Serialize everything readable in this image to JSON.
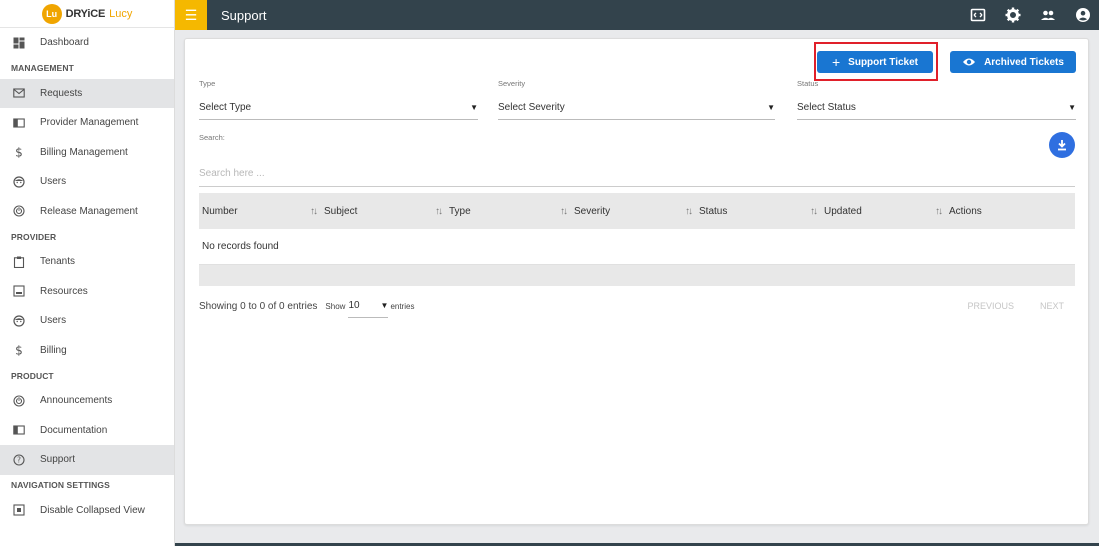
{
  "app": {
    "logo_badge": "Lu",
    "logo_name": "DRYiCE",
    "logo_product": "Lucy",
    "page_title": "Support"
  },
  "sidebar": {
    "items": [
      {
        "type": "item",
        "label": "Dashboard",
        "icon": "dashboard-icon"
      },
      {
        "type": "section",
        "label": "MANAGEMENT"
      },
      {
        "type": "item",
        "label": "Requests",
        "icon": "mail-icon",
        "active": true
      },
      {
        "type": "item",
        "label": "Provider Management",
        "icon": "book-icon"
      },
      {
        "type": "item",
        "label": "Billing Management",
        "icon": "dollar-icon"
      },
      {
        "type": "item",
        "label": "Users",
        "icon": "face-icon"
      },
      {
        "type": "item",
        "label": "Release Management",
        "icon": "release-icon"
      },
      {
        "type": "section",
        "label": "PROVIDER"
      },
      {
        "type": "item",
        "label": "Tenants",
        "icon": "clipboard-icon"
      },
      {
        "type": "item",
        "label": "Resources",
        "icon": "resources-icon"
      },
      {
        "type": "item",
        "label": "Users",
        "icon": "face-icon"
      },
      {
        "type": "item",
        "label": "Billing",
        "icon": "dollar-icon"
      },
      {
        "type": "section",
        "label": "PRODUCT"
      },
      {
        "type": "item",
        "label": "Announcements",
        "icon": "release-icon"
      },
      {
        "type": "item",
        "label": "Documentation",
        "icon": "book-icon"
      },
      {
        "type": "item",
        "label": "Support",
        "icon": "help-icon",
        "active": true
      },
      {
        "type": "section",
        "label": "NAVIGATION SETTINGS"
      },
      {
        "type": "item",
        "label": "Disable Collapsed View",
        "icon": "collapse-icon"
      }
    ]
  },
  "toolbar": {
    "support_ticket": "Support Ticket",
    "archived_tickets": "Archived Tickets"
  },
  "filters": {
    "type_label": "Type",
    "type_value": "Select Type",
    "severity_label": "Severity",
    "severity_value": "Select Severity",
    "status_label": "Status",
    "status_value": "Select Status"
  },
  "search": {
    "label": "Search:",
    "placeholder": "Search here ..."
  },
  "table": {
    "columns": [
      "Number",
      "Subject",
      "Type",
      "Severity",
      "Status",
      "Updated",
      "Actions"
    ],
    "empty_text": "No records found"
  },
  "pager": {
    "showing": "Showing 0 to 0 of 0 entries",
    "show_label": "Show",
    "page_size": "10",
    "entries_label": "entries",
    "previous": "PREVIOUS",
    "next": "NEXT"
  },
  "colors": {
    "topbar": "#33434c",
    "accent_yellow": "#f5b800",
    "primary_blue": "#1976d2",
    "highlight_red": "#e0202a"
  }
}
